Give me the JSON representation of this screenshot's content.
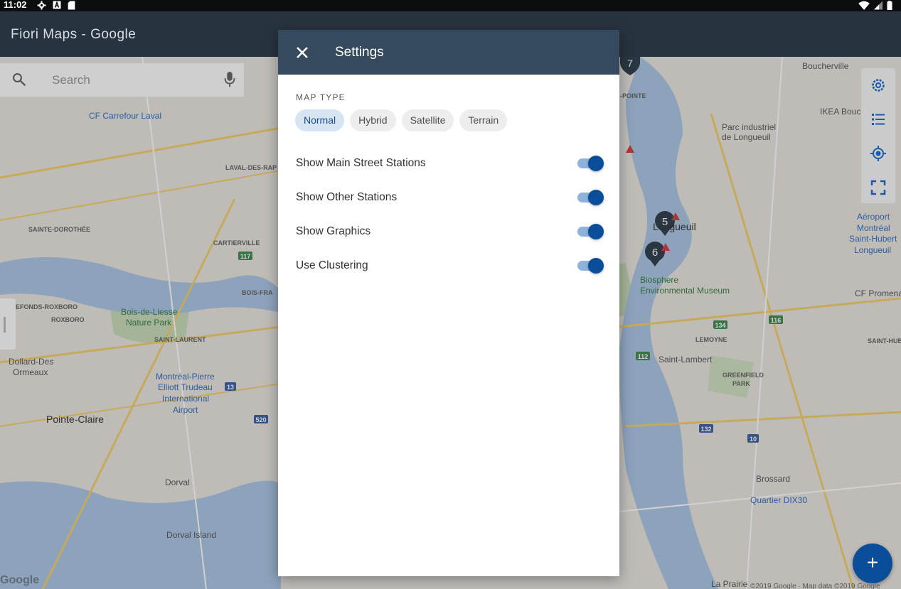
{
  "status_bar": {
    "time": "11:02",
    "icons": [
      "gear-icon",
      "a-icon",
      "sdcard-icon"
    ],
    "right_icons": [
      "wifi-icon",
      "signal-icon",
      "battery-icon"
    ]
  },
  "app_bar": {
    "title": "Fiori Maps - Google"
  },
  "search": {
    "placeholder": "Search"
  },
  "map": {
    "labels": [
      "CF Carrefour Laval",
      "LAVAL-DES-RAP",
      "SAINTE-DOROTHÉE",
      "CARTIERVILLE",
      "BOIS-FRA",
      "EFONDS-ROXBORO",
      "ROXBORO",
      "Bois-de-Liesse",
      "Nature Park",
      "SAINT-LAURENT",
      "Dollard-Des",
      "Ormeaux",
      "Montréal-Pierre",
      "Elliott Trudeau",
      "International",
      "Airport",
      "Pointe-Claire",
      "Dorval",
      "Dorval Island",
      "Boucherville",
      "IKEA Bouc",
      "Parc industriel",
      "de Longueuil",
      "-POINTE",
      "Longueuil",
      "Aéroport",
      "Montréal",
      "Saint-Hubert",
      "Longueuil",
      "Biosphere",
      "Environmental Museum",
      "CF Promena",
      "LEMOYNE",
      "SAINT-HUB",
      "Saint-Lambert",
      "GREENFIELD",
      "PARK",
      "Brossard",
      "Quartier DIX30",
      "La Prairie"
    ],
    "markers": [
      "7",
      "5",
      "6"
    ],
    "road_shields": [
      "117",
      "13",
      "520",
      "116",
      "134",
      "112",
      "132",
      "10"
    ],
    "attribution": "Google",
    "copyright": "©2019 Google · Map data ©2019 Google"
  },
  "tools": [
    "settings-icon",
    "list-icon",
    "locate-icon",
    "fullscreen-icon"
  ],
  "fab": {
    "label": "+"
  },
  "dialog": {
    "title": "Settings",
    "map_type_label": "MAP TYPE",
    "map_types": [
      "Normal",
      "Hybrid",
      "Satellite",
      "Terrain"
    ],
    "selected_map_type": "Normal",
    "toggles": [
      {
        "label": "Show Main Street Stations",
        "on": true
      },
      {
        "label": "Show Other Stations",
        "on": true
      },
      {
        "label": "Show Graphics",
        "on": true
      },
      {
        "label": "Use Clustering",
        "on": true
      }
    ],
    "accent_color": "#0a4e9a",
    "header_color": "#354a5f"
  }
}
